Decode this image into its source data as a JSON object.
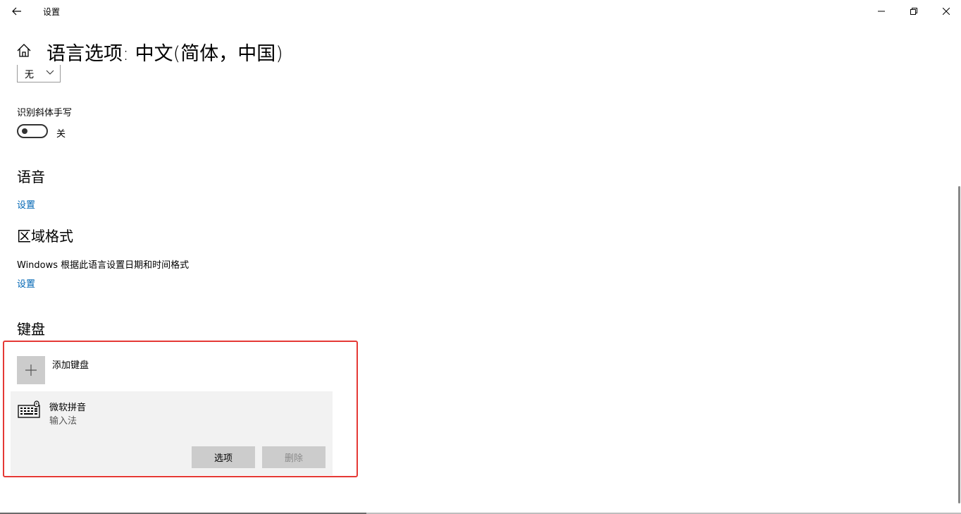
{
  "titlebar": {
    "title": "设置",
    "icons": {
      "back": "back-arrow-icon",
      "minimize": "minimize-icon",
      "maximize": "restore-icon",
      "close": "close-icon"
    }
  },
  "header": {
    "title": "语言选项: 中文(简体，中国)",
    "home_icon": "home-icon"
  },
  "handwriting": {
    "dropdown_value": "无",
    "italic_label": "识别斜体手写",
    "toggle_state": "关"
  },
  "speech": {
    "title": "语音",
    "settings_link": "设置"
  },
  "region": {
    "title": "区域格式",
    "description": "Windows 根据此语言设置日期和时间格式",
    "settings_link": "设置"
  },
  "keyboard": {
    "title": "键盘",
    "add_label": "添加键盘",
    "items": [
      {
        "name": "微软拼音",
        "subtitle": "输入法",
        "options_label": "选项",
        "remove_label": "删除"
      }
    ]
  },
  "colors": {
    "link": "#0066b4",
    "highlight": "#e53935",
    "item_bg": "#f2f2f2",
    "button_bg": "#cccccc"
  }
}
